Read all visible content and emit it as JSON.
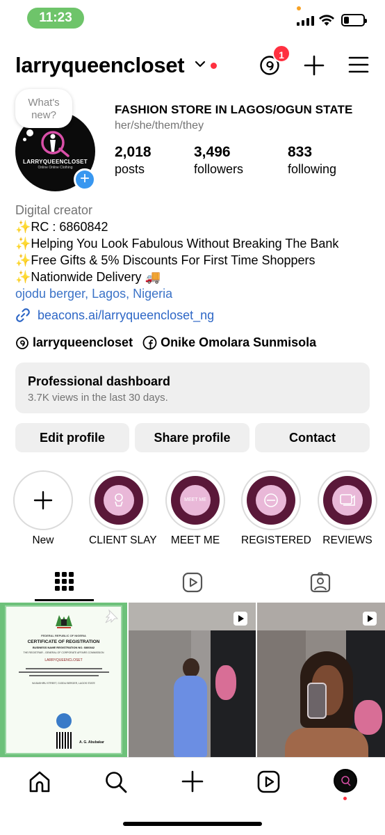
{
  "status_bar": {
    "time": "11:23"
  },
  "header": {
    "username": "larryqueencloset",
    "threads_badge_count": "1"
  },
  "profile": {
    "note_text": "What's new?",
    "avatar_brand": "LARRYQUEENCLOSET",
    "avatar_tagline": "Online Online Clothing",
    "full_name": "FASHION STORE IN LAGOS/OGUN STATE",
    "pronouns": "her/she/them/they",
    "stats": [
      {
        "value": "2,018",
        "label": "posts"
      },
      {
        "value": "3,496",
        "label": "followers"
      },
      {
        "value": "833",
        "label": "following"
      }
    ]
  },
  "bio": {
    "category": "Digital creator",
    "lines": [
      "✨RC : 6860842",
      "✨Helping You Look Fabulous Without Breaking The Bank",
      "✨Free Gifts & 5% Discounts For First Time Shoppers",
      "✨Nationwide Delivery 🚚"
    ],
    "location": "ojodu berger, Lagos, Nigeria",
    "link": "beacons.ai/larryqueencloset_ng"
  },
  "social": {
    "threads": "larryqueencloset",
    "facebook": "Onike Omolara Sunmisola"
  },
  "dashboard": {
    "title": "Professional dashboard",
    "subtitle": "3.7K views in the last 30 days."
  },
  "buttons": {
    "edit": "Edit profile",
    "share": "Share profile",
    "contact": "Contact"
  },
  "highlights": [
    {
      "label": "New"
    },
    {
      "label": "CLIENT SLAY"
    },
    {
      "label": "MEET ME",
      "inner_text": "MEET ME"
    },
    {
      "label": "REGISTERED"
    },
    {
      "label": "REVIEWS"
    }
  ],
  "certificate": {
    "country": "FEDERAL REPUBLIC OF NIGERIA",
    "title": "CERTIFICATE OF REGISTRATION",
    "reg_no": "BUSINESS NAME REGISTRATION NO. 6860842",
    "registrar": "THE REGISTRAR - GENERAL OF CORPORATE AFFAIRS COMMISSION",
    "business": "LARRYQUEENCLOSET",
    "address": "9A BASHIRU STREET, OJODU BERGER, LAGOS STATE",
    "signer": "A. G. Abubakar"
  },
  "colors": {
    "accent_blue": "#3897f0",
    "notification_red": "#ff3040",
    "link_blue": "#2e67c6",
    "highlight_purple": "#5a1839",
    "status_green": "#6ec46a"
  }
}
